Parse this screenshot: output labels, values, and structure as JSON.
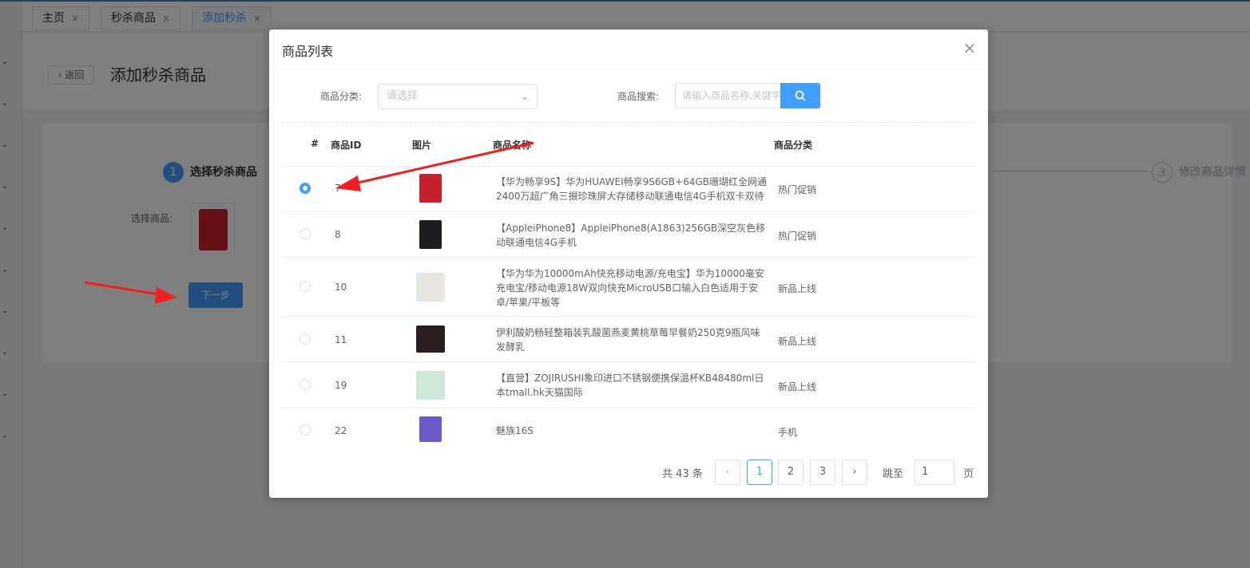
{
  "tabs": [
    {
      "label": "主页",
      "close": "×"
    },
    {
      "label": "秒杀商品",
      "close": "×"
    },
    {
      "label": "添加秒杀",
      "close": "×"
    }
  ],
  "page": {
    "back_label": "返回",
    "back_icon": "‹",
    "title": "添加秒杀商品",
    "step1_num": "1",
    "step1_label": "选择秒杀商品",
    "step3_num": "3",
    "step3_label": "修改商品详情",
    "select_goods_label": "选择商品:",
    "next_button": "下一步"
  },
  "dialog": {
    "title": "商品列表",
    "close_icon": "×",
    "category_label": "商品分类:",
    "category_placeholder": "请选择",
    "search_label": "商品搜索:",
    "search_placeholder": "请输入商品名称,关键字",
    "columns": {
      "index": "#",
      "id": "商品ID",
      "image": "图片",
      "name": "商品名称",
      "category": "商品分类"
    },
    "rows": [
      {
        "id": "7",
        "name": "【华为畅享9S】华为HUAWEI畅享9S6GB+64GB珊瑚红全网通2400万超广角三摄珍珠屏大存储移动联通电信4G手机双卡双待",
        "category": "热门促销",
        "selected": true,
        "thumb_color": "#c8202c"
      },
      {
        "id": "8",
        "name": "【AppleiPhone8】AppleiPhone8(A1863)256GB深空灰色移动联通电信4G手机",
        "category": "热门促销",
        "selected": false,
        "thumb_color": "#1e1e22"
      },
      {
        "id": "10",
        "name": "【华为华为10000mAh快充移动电源/充电宝】华为10000毫安充电宝/移动电源18W双向快充MicroUSB口输入白色适用于安卓/苹果/平板等",
        "category": "新品上线",
        "selected": false,
        "thumb_color": "#e9e5e1"
      },
      {
        "id": "11",
        "name": "伊利酸奶畅轻整箱装乳酸菌燕麦黄桃草莓早餐奶250克9瓶风味发酵乳",
        "category": "新品上线",
        "selected": false,
        "thumb_color": "#2a1e1e"
      },
      {
        "id": "19",
        "name": "【直营】ZOJIRUSHI象印进口不锈钢便携保温杯KB48480ml日本tmall.hk天猫国际",
        "category": "新品上线",
        "selected": false,
        "thumb_color": "#cfe7d6"
      },
      {
        "id": "22",
        "name": "魅族16S",
        "category": "手机",
        "selected": false,
        "thumb_color": "#6b58c9"
      }
    ],
    "pagination": {
      "total": "共 43 条",
      "prev": "‹",
      "pages": [
        "1",
        "2",
        "3"
      ],
      "current": "1",
      "next": "›",
      "jump_label": "跳至",
      "jump_value": "1",
      "jump_suffix": "页"
    }
  },
  "colors": {
    "primary": "#409eff",
    "annotation": "#ff0000"
  }
}
